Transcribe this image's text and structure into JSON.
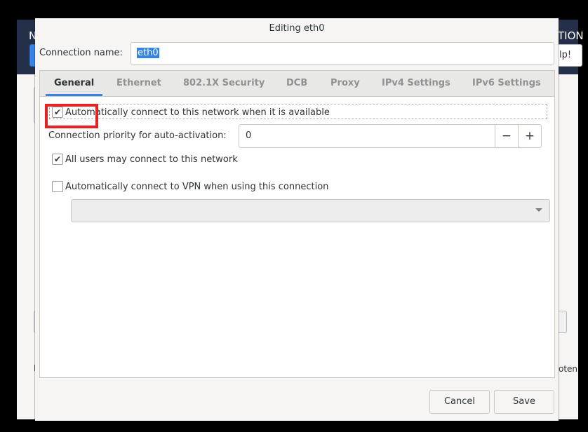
{
  "background_window": {
    "header_left_text": "N",
    "header_right_text": "TION",
    "help_button_label": "lp!",
    "side_text": "oten"
  },
  "dialog": {
    "title": "Editing eth0",
    "connection_name_label": "Connection name:",
    "connection_name_value": "eth0"
  },
  "tabs": [
    {
      "label": "General",
      "active": true
    },
    {
      "label": "Ethernet",
      "active": false
    },
    {
      "label": "802.1X Security",
      "active": false
    },
    {
      "label": "DCB",
      "active": false
    },
    {
      "label": "Proxy",
      "active": false
    },
    {
      "label": "IPv4 Settings",
      "active": false
    },
    {
      "label": "IPv6 Settings",
      "active": false
    }
  ],
  "general": {
    "auto_connect": {
      "label": "Automatically connect to this network when it is available",
      "checked": true
    },
    "priority": {
      "label": "Connection priority for auto-activation:",
      "value": "0",
      "minus": "−",
      "plus": "+"
    },
    "all_users": {
      "label": "All users may connect to this network",
      "checked": true
    },
    "auto_vpn": {
      "label": "Automatically connect to VPN when using this connection",
      "checked": false
    },
    "vpn_combo_value": ""
  },
  "buttons": {
    "cancel": "Cancel",
    "save": "Save"
  },
  "colors": {
    "accent": "#3584e4",
    "highlight_box": "#e52222",
    "header": "#243049"
  }
}
